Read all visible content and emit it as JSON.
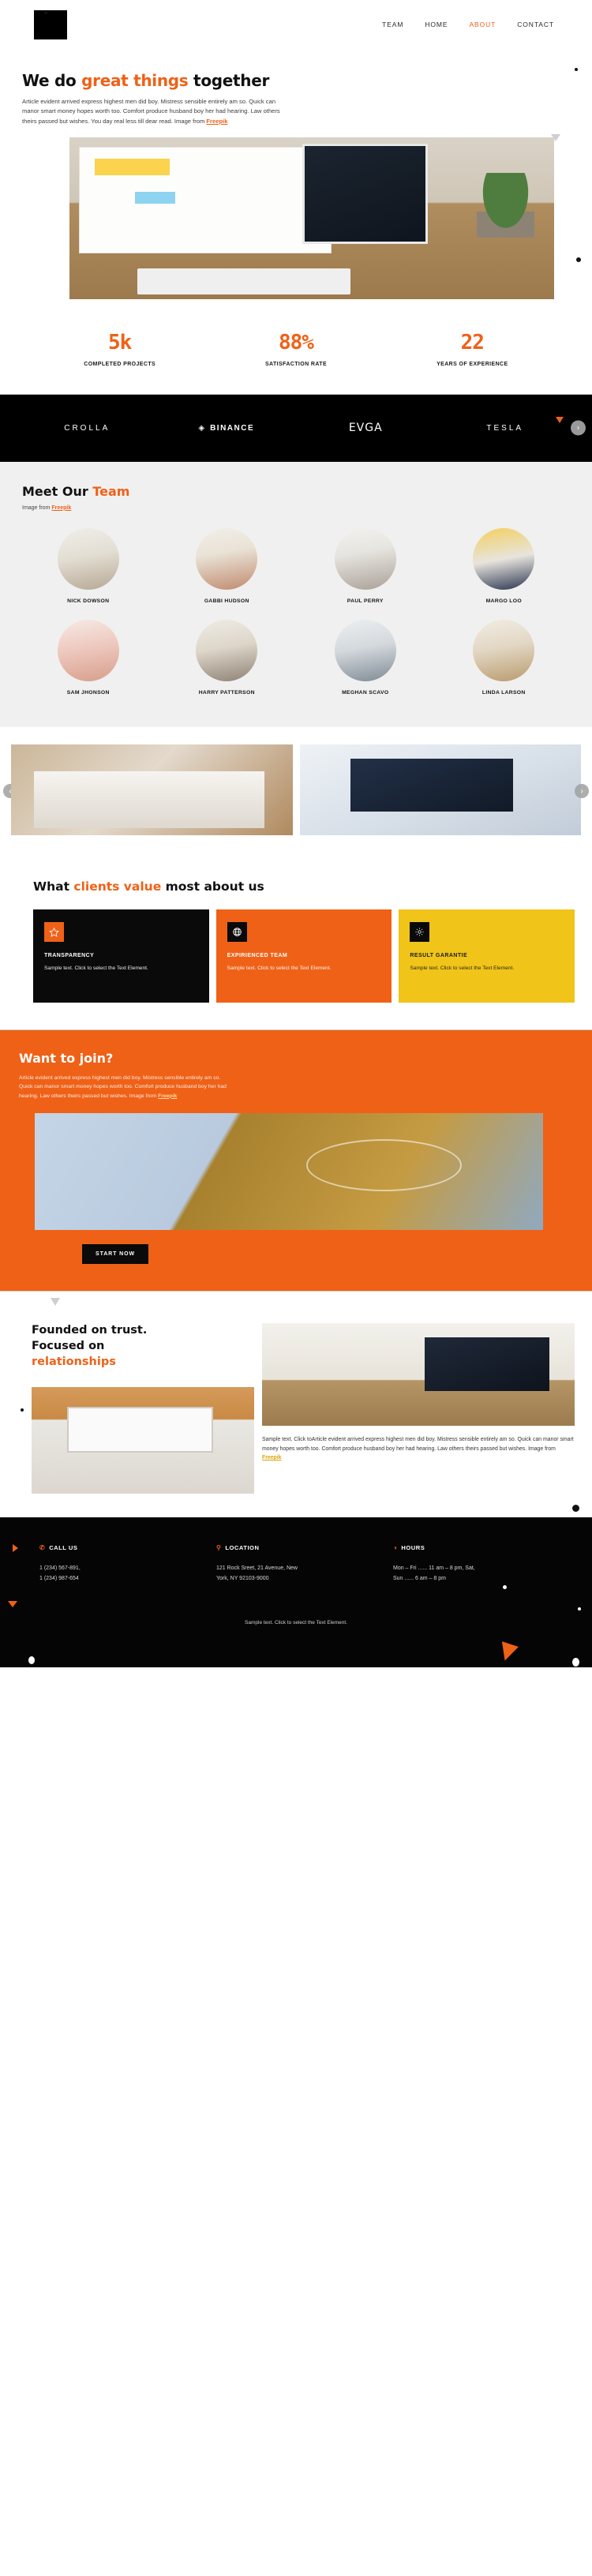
{
  "header": {
    "logo_name": "logo-mark",
    "nav": [
      {
        "label": "TEAM",
        "active": false
      },
      {
        "label": "HOME",
        "active": false
      },
      {
        "label": "ABOUT",
        "active": true
      },
      {
        "label": "CONTACT",
        "active": false
      }
    ]
  },
  "hero": {
    "title_part1": "We do ",
    "title_accent": "great things",
    "title_part2": " together",
    "paragraph": "Article evident arrived express highest men did boy. Mistress sensible entirely am so. Quick can manor smart money hopes worth too. Comfort produce husband boy her had hearing. Law others theirs passed but wishes. You day real less till dear read. Image from ",
    "paragraph_link": "Freepik",
    "image_name": "marketing-desk-photo"
  },
  "stats": [
    {
      "value": "5k",
      "label": "COMPLETED PROJECTS"
    },
    {
      "value": "88%",
      "label": "SATISFACTION RATE"
    },
    {
      "value": "22",
      "label": "YEARS OF EXPERIENCE"
    }
  ],
  "brands": {
    "items": [
      {
        "label": "CROLLA",
        "icon": ""
      },
      {
        "label": "BINANCE",
        "icon": "◈"
      },
      {
        "label": "EVGA",
        "icon": ""
      },
      {
        "label": "TESLA",
        "icon": ""
      }
    ],
    "next_label": "›"
  },
  "team": {
    "title_part1": "Meet Our ",
    "title_accent": "Team",
    "subtitle_text": "Image from ",
    "subtitle_link": "Freepik",
    "members": [
      {
        "name": "NICK DOWSON"
      },
      {
        "name": "GABBI HUDSON"
      },
      {
        "name": "PAUL PERRY"
      },
      {
        "name": "MARGO LOO"
      },
      {
        "name": "SAM JHONSON"
      },
      {
        "name": "HARRY PATTERSON"
      },
      {
        "name": "MEGHAN SCAVO"
      },
      {
        "name": "LINDA LARSON"
      }
    ]
  },
  "gallery": {
    "prev_label": "‹",
    "next_label": "›",
    "items": [
      {
        "name": "team-meeting-photo"
      },
      {
        "name": "dashboard-analytics-photo"
      }
    ]
  },
  "values": {
    "title_part1": "What ",
    "title_accent": "clients value",
    "title_part2": " most about us",
    "cards": [
      {
        "icon": "star-icon",
        "glyph": "☆",
        "title": "TRANSPARENCY",
        "text": "Sample text. Click to select the Text Element.",
        "theme": "black"
      },
      {
        "icon": "globe-icon",
        "glyph": "⊕",
        "title": "EXPIRIENCED TEAM",
        "text": "Sample text. Click to select the Text Element.",
        "theme": "orange"
      },
      {
        "icon": "gear-icon",
        "glyph": "⚙",
        "title": "RESULT GARANTIE",
        "text": "Sample text. Click to select the Text Element.",
        "theme": "yellow"
      }
    ]
  },
  "join": {
    "title": "Want to join?",
    "paragraph": "Article evident arrived express highest men did boy. Mistress sensible entirely am so. Quick can manor smart money hopes worth too. Comfort produce husband boy her had hearing. Law others theirs passed but wishes. Image from ",
    "paragraph_link": "Freepik",
    "image_name": "woman-tablet-photo",
    "button_label": "START NOW"
  },
  "founded": {
    "heading_line1": "Founded on trust.",
    "heading_line2": "Focused on",
    "heading_accent": "relationships",
    "image_a_name": "laptop-hands-photo",
    "image_b_name": "marketing-board-photo",
    "paragraph": "Sample text. Click toArticle evident arrived express highest men did boy. Mistress sensible entirely am so. Quick can manor smart money hopes worth too. Comfort produce husband boy her had hearing. Law others theirs passed but wishes. Image from ",
    "paragraph_link": "Freepik"
  },
  "footer": {
    "columns": [
      {
        "icon": "phone-icon",
        "glyph": "✆",
        "title": "CALL US",
        "line1": "1 (234) 567-891,",
        "line2": "1 (234) 987-654"
      },
      {
        "icon": "map-pin-icon",
        "glyph": "⚲",
        "title": "LOCATION",
        "line1": "121 Rock Sreet, 21 Avenue, New",
        "line2": "York, NY 92103-9000"
      },
      {
        "icon": "clock-icon",
        "glyph": "◑",
        "title": "HOURS",
        "line1": "Mon – Fri ...... 11 am – 8 pm, Sat,",
        "line2": "Sun  ...... 6 am – 8 pm"
      }
    ],
    "note": "Sample text. Click to select the Text Element."
  },
  "colors": {
    "accent": "#ef6117",
    "yellow": "#f0c419",
    "black": "#0a0a0a",
    "light_gray": "#f0f0f0"
  }
}
